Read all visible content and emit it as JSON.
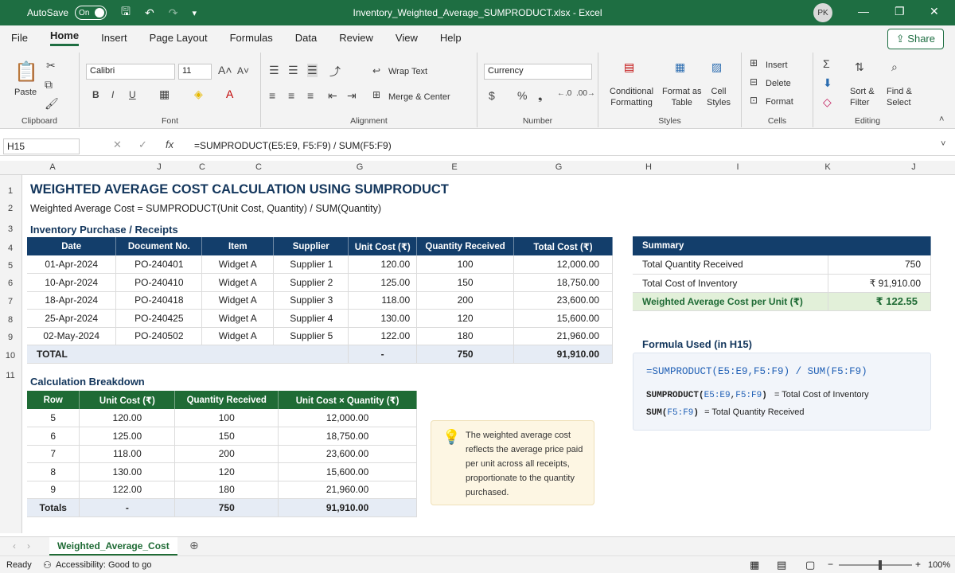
{
  "titlebar": {
    "autosave_label": "AutoSave",
    "autosave_state": "On",
    "doc_title": "Inventory_Weighted_Average_SUMPRODUCT.xlsx  -  Excel",
    "avatar_initials": "PK"
  },
  "menu": {
    "items": [
      "File",
      "Home",
      "Insert",
      "Page Layout",
      "Formulas",
      "Data",
      "Review",
      "View",
      "Help"
    ],
    "active": "Home",
    "share_label": "Share"
  },
  "ribbon": {
    "clipboard": {
      "paste": "Paste",
      "label": "Clipboard"
    },
    "font": {
      "name": "Calibri",
      "size": "11",
      "label": "Font"
    },
    "alignment": {
      "wrap": "Wrap Text",
      "merge": "Merge & Center",
      "label": "Alignment"
    },
    "number": {
      "format": "Currency",
      "label": "Number"
    },
    "styles": {
      "conditional": "Conditional\nFormatting",
      "format_table": "Format as\nTable",
      "cell_styles": "Cell\nStyles",
      "label": "Styles"
    },
    "cells": {
      "insert": "Insert",
      "delete": "Delete",
      "format": "Format",
      "label": "Cells"
    },
    "editing": {
      "sort": "Sort &\nFilter",
      "find": "Find &\nSelect",
      "label": "Editing"
    }
  },
  "formula_bar": {
    "name_box": "H15",
    "formula": "=SUMPRODUCT(E5:E9, F5:F9) / SUM(F5:F9)"
  },
  "grid": {
    "columns": [
      "A",
      "J",
      "C",
      "C",
      "G",
      "E",
      "G",
      "H",
      "I",
      "K",
      "J"
    ],
    "rows": [
      "1",
      "2",
      "3",
      "4",
      "5",
      "6",
      "7",
      "8",
      "9",
      "10",
      "11"
    ]
  },
  "sheet": {
    "title": "WEIGHTED AVERAGE COST CALCULATION USING SUMPRODUCT",
    "subtitle": "Weighted Average Cost = SUMPRODUCT(Unit Cost, Quantity) / SUM(Quantity)",
    "inventory": {
      "title": "Inventory Purchase / Receipts",
      "headers": [
        "Date",
        "Document No.",
        "Item",
        "Supplier",
        "Unit Cost (₹)",
        "Quantity Received",
        "Total Cost (₹)"
      ],
      "rows": [
        [
          "01-Apr-2024",
          "PO-240401",
          "Widget A",
          "Supplier 1",
          "120.00",
          "100",
          "12,000.00"
        ],
        [
          "10-Apr-2024",
          "PO-240410",
          "Widget A",
          "Supplier 2",
          "125.00",
          "150",
          "18,750.00"
        ],
        [
          "18-Apr-2024",
          "PO-240418",
          "Widget A",
          "Supplier 3",
          "118.00",
          "200",
          "23,600.00"
        ],
        [
          "25-Apr-2024",
          "PO-240425",
          "Widget A",
          "Supplier 4",
          "130.00",
          "120",
          "15,600.00"
        ],
        [
          "02-May-2024",
          "PO-240502",
          "Widget A",
          "Supplier 5",
          "122.00",
          "180",
          "21,960.00"
        ]
      ],
      "total": {
        "label": "TOTAL",
        "unit_cost": "-",
        "quantity": "750",
        "total_cost": "91,910.00"
      }
    },
    "breakdown": {
      "title": "Calculation Breakdown",
      "headers": [
        "Row",
        "Unit Cost (₹)",
        "Quantity Received",
        "Unit Cost × Quantity (₹)"
      ],
      "rows": [
        [
          "5",
          "120.00",
          "100",
          "12,000.00"
        ],
        [
          "6",
          "125.00",
          "150",
          "18,750.00"
        ],
        [
          "7",
          "118.00",
          "200",
          "23,600.00"
        ],
        [
          "8",
          "130.00",
          "120",
          "15,600.00"
        ],
        [
          "9",
          "122.00",
          "180",
          "21,960.00"
        ]
      ],
      "total": {
        "label": "Totals",
        "unit_cost": "-",
        "quantity": "750",
        "product": "91,910.00"
      }
    },
    "summary": {
      "header": "Summary",
      "total_qty_label": "Total Quantity Received",
      "total_qty": "750",
      "total_cost_label": "Total Cost of Inventory",
      "total_cost": "₹ 91,910.00",
      "wac_label": "Weighted Average Cost per Unit (₹)",
      "wac": "₹ 122.55"
    },
    "formula_used": {
      "title": "Formula Used (in H15)",
      "formula_a": "=SUMPRODUCT(",
      "formula_b": "E5:E9",
      "formula_c": ",",
      "formula_d": "F5:F9",
      "formula_e": ") / SUM(",
      "formula_f": "F5:F9",
      "formula_g": ")",
      "line1_fn": "SUMPRODUCT(",
      "line1_r1": "E5:E9",
      "line1_c": ",",
      "line1_r2": "F5:F9",
      "line1_end": ")",
      "line1_desc": "= Total Cost of Inventory",
      "line2_fn": "SUM(",
      "line2_r": "F5:F9",
      "line2_end": ")",
      "line2_desc": "= Total Quantity Received"
    },
    "note": "The weighted average cost reflects the average price paid per unit across all receipts, proportionate to the quantity purchased."
  },
  "tabs": {
    "active": "Weighted_Average_Cost"
  },
  "status": {
    "ready": "Ready",
    "accessibility": "Accessibility: Good to go",
    "zoom": "100%"
  },
  "colors": {
    "excel_green": "#1e6e42",
    "navy_header": "#133e6b",
    "green_header": "#1f6b35",
    "formula_blue": "#1f5fb5"
  }
}
